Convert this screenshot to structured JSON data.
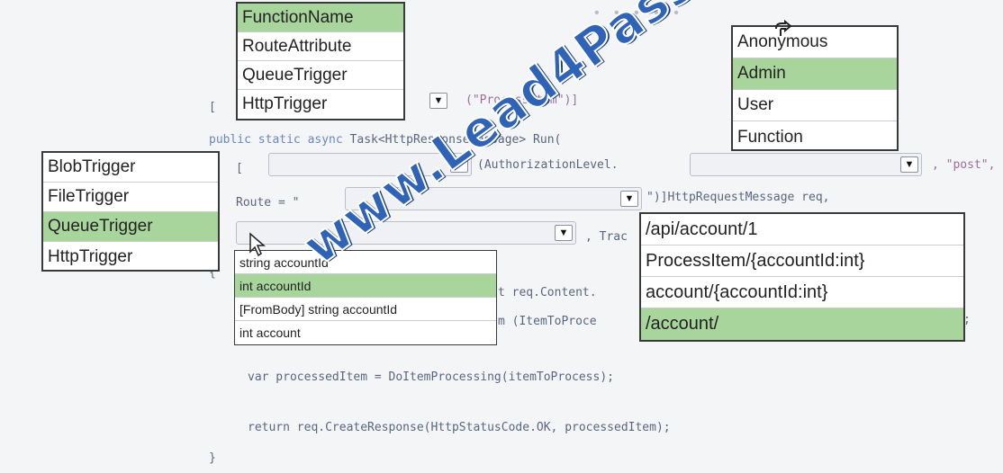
{
  "decor": {
    "dots": "• • • • •"
  },
  "code": {
    "open_bracket": "[",
    "func_suffix": "(\"ProcessItem\")]",
    "public_line_a": "public static async ",
    "public_line_b": "Task<HttpResponseMessage> Run(",
    "param_open": "[",
    "auth_level": "(AuthorizationLevel.",
    "post_text": ", \"post\",",
    "route_prefix": "Route = \"",
    "route_suffix": "\")]HttpRequestMessage req,",
    "trace_text": ", Trac",
    "brace_open": "{",
    "line_req_content": "t req.Content.",
    "line_item_to_proc": "m (ItemToProce",
    "line_semicolon": ";",
    "line_var": "var processedItem = DoItemProcessing(itemToProcess);",
    "line_return": "return req.CreateResponse(HttpStatusCode.OK, processedItem);",
    "brace_close": "}"
  },
  "function_list": [
    "FunctionName",
    "RouteAttribute",
    "QueueTrigger",
    "HttpTrigger"
  ],
  "function_list_selected": 0,
  "trigger_list": [
    "BlobTrigger",
    "FileTrigger",
    "QueueTrigger",
    "HttpTrigger"
  ],
  "trigger_list_selected": 2,
  "auth_list": [
    "Anonymous",
    "Admin",
    "User",
    "Function"
  ],
  "auth_list_selected": 1,
  "param_list": [
    "string accountId",
    "int accountId",
    "[FromBody] string accountId",
    "int account"
  ],
  "param_list_selected": 1,
  "route_list": [
    "/api/account/1",
    "ProcessItem/{accountId:int}",
    "account/{accountId:int}",
    "/account/"
  ],
  "route_list_selected": 3,
  "watermark": "www.Lead4Pass.com",
  "colors": {
    "selected": "#a8d59c",
    "watermark": "#2f63b8"
  }
}
